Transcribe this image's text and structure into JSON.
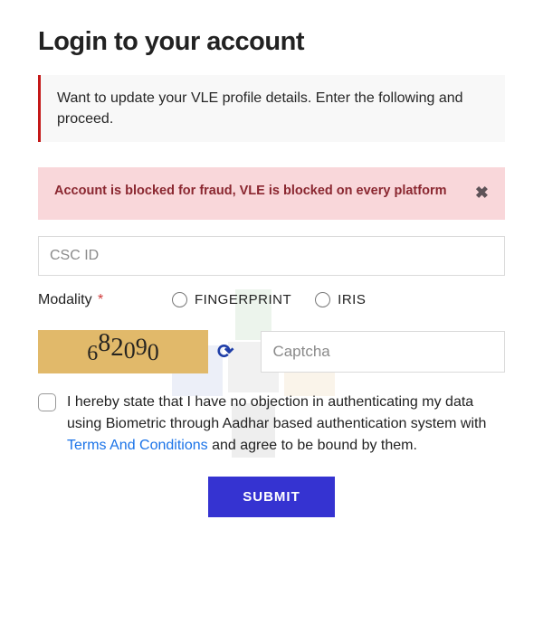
{
  "title": "Login to your account",
  "info": "Want to update your VLE profile details. Enter the following and proceed.",
  "alert": {
    "text": "Account is blocked for fraud, VLE is blocked on every platform",
    "close": "✖"
  },
  "csc_placeholder": "CSC ID",
  "csc_value": "",
  "modality": {
    "label": "Modality",
    "required": "*",
    "options": {
      "fp": "FINGERPRINT",
      "iris": "IRIS"
    }
  },
  "captcha": {
    "d0": "6",
    "d1": "8",
    "d2": "2",
    "d3": "0",
    "d4": "9",
    "d5": "0",
    "refresh_icon": "⟳",
    "placeholder": "Captcha",
    "value": ""
  },
  "consent": {
    "pre": "I hereby state that I have no objection in authenticating my data using Biometric through Aadhar based authentication system with ",
    "link": "Terms And Conditions",
    "post": " and agree to be bound by them."
  },
  "submit": "SUBMIT"
}
